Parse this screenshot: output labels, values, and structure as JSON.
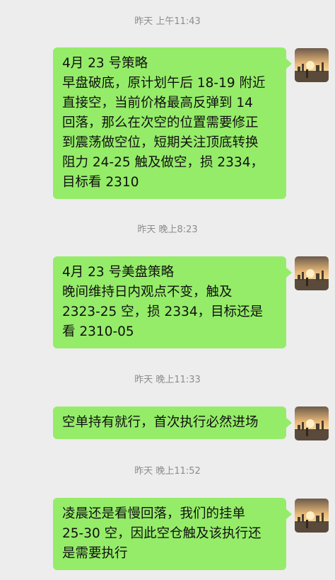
{
  "messages": [
    {
      "timestamp": "昨天 上午11:43",
      "text": "4月 23 号策略\n早盘破底，原计划午后 18-19 附近\n直接空，当前价格最高反弹到 14\n回落，那么在次空的位置需要修正\n到震荡做空位，短期关注顶底转换\n阻力 24-25 触及做空，损 2334，\n目标看 2310",
      "avatar_icon": "sunset-cityscape-avatar-icon"
    },
    {
      "timestamp": "昨天 晚上8:23",
      "text": "4月 23 号美盘策略\n晚间维持日内观点不变，触及\n2323-25 空，损 2334，目标还是\n看 2310-05",
      "avatar_icon": "sunset-cityscape-avatar-icon"
    },
    {
      "timestamp": "昨天 晚上11:33",
      "text": "空单持有就行，首次执行必然进场",
      "avatar_icon": "sunset-cityscape-avatar-icon"
    },
    {
      "timestamp": "昨天 晚上11:52",
      "text": "凌晨还是看慢回落，我们的挂单\n25-30 空，因此空仓触及该执行还\n是需要执行",
      "avatar_icon": "sunset-cityscape-avatar-icon"
    }
  ],
  "colors": {
    "background": "#ededed",
    "bubble": "#95ec69",
    "timestamp_text": "#8c8c8c",
    "message_text": "#111111"
  }
}
